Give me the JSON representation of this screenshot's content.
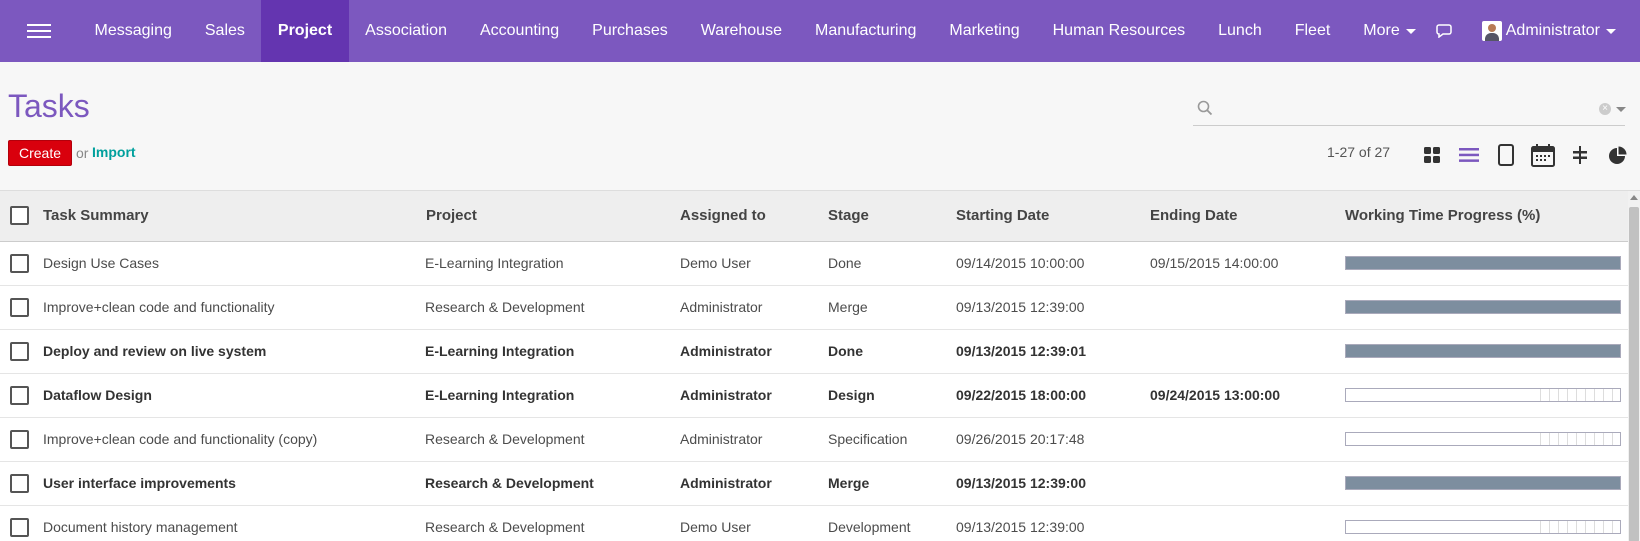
{
  "navbar": {
    "menu": [
      {
        "label": "Messaging"
      },
      {
        "label": "Sales"
      },
      {
        "label": "Project",
        "active": true
      },
      {
        "label": "Association"
      },
      {
        "label": "Accounting"
      },
      {
        "label": "Purchases"
      },
      {
        "label": "Warehouse"
      },
      {
        "label": "Manufacturing"
      },
      {
        "label": "Marketing"
      },
      {
        "label": "Human Resources"
      },
      {
        "label": "Lunch"
      },
      {
        "label": "Fleet"
      },
      {
        "label": "More"
      }
    ],
    "user": "Administrator",
    "colors": {
      "bar": "#7c58bf",
      "active": "#6435b0"
    }
  },
  "control": {
    "title": "Tasks",
    "create_label": "Create",
    "or_label": "or",
    "import_label": "Import",
    "search_placeholder": "",
    "pager": "1-27 of 27",
    "views": [
      "kanban-view-icon",
      "list-view-icon",
      "form-view-icon",
      "calendar-view-icon",
      "gantt-view-icon",
      "graph-view-icon"
    ],
    "active_view": "list-view-icon"
  },
  "table": {
    "columns": [
      "Task Summary",
      "Project",
      "Assigned to",
      "Stage",
      "Starting Date",
      "Ending Date",
      "Working Time Progress (%)"
    ],
    "rows": [
      {
        "task": "Design Use Cases",
        "project": "E-Learning Integration",
        "assigned": "Demo User",
        "stage": "Done",
        "start": "09/14/2015 10:00:00",
        "end": "09/15/2015 14:00:00",
        "progress": 100,
        "bold": false
      },
      {
        "task": "Improve+clean code and functionality",
        "project": "Research & Development",
        "assigned": "Administrator",
        "stage": "Merge",
        "start": "09/13/2015 12:39:00",
        "end": "",
        "progress": 100,
        "bold": false
      },
      {
        "task": "Deploy and review on live system",
        "project": "E-Learning Integration",
        "assigned": "Administrator",
        "stage": "Done",
        "start": "09/13/2015 12:39:01",
        "end": "",
        "progress": 100,
        "bold": true
      },
      {
        "task": "Dataflow Design",
        "project": "E-Learning Integration",
        "assigned": "Administrator",
        "stage": "Design",
        "start": "09/22/2015 18:00:00",
        "end": "09/24/2015 13:00:00",
        "progress": 0,
        "bold": true
      },
      {
        "task": "Improve+clean code and functionality (copy)",
        "project": "Research & Development",
        "assigned": "Administrator",
        "stage": "Specification",
        "start": "09/26/2015 20:17:48",
        "end": "",
        "progress": 0,
        "bold": false
      },
      {
        "task": "User interface improvements",
        "project": "Research & Development",
        "assigned": "Administrator",
        "stage": "Merge",
        "start": "09/13/2015 12:39:00",
        "end": "",
        "progress": 100,
        "bold": true
      },
      {
        "task": "Document history management",
        "project": "Research & Development",
        "assigned": "Demo User",
        "stage": "Development",
        "start": "09/13/2015 12:39:00",
        "end": "",
        "progress": 0,
        "bold": false
      }
    ]
  }
}
